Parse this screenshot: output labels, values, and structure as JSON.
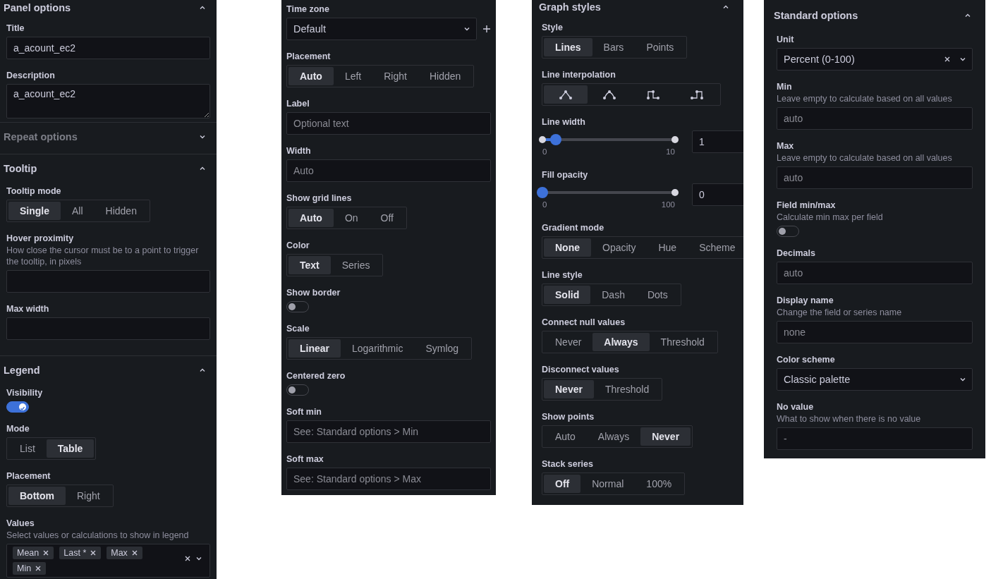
{
  "panels": [
    {
      "sections": [
        {
          "title": "Panel options",
          "expanded": true,
          "fields": [
            {
              "kind": "input",
              "label": "Title",
              "value": "a_acount_ec2"
            },
            {
              "kind": "textarea",
              "label": "Description",
              "value": "a_acount_ec2"
            }
          ]
        },
        {
          "title": "Repeat options",
          "expanded": false
        },
        {
          "title": "Tooltip",
          "expanded": true,
          "fields": [
            {
              "kind": "radio",
              "label": "Tooltip mode",
              "options": [
                {
                  "label": "Single",
                  "selected": true
                },
                {
                  "label": "All",
                  "selected": false
                },
                {
                  "label": "Hidden",
                  "selected": false
                }
              ]
            },
            {
              "kind": "input",
              "label": "Hover proximity",
              "description": "How close the cursor must be to a point to trigger the tooltip, in pixels"
            },
            {
              "kind": "input",
              "label": "Max width"
            }
          ]
        },
        {
          "title": "Legend",
          "expanded": true,
          "fields": [
            {
              "kind": "toggle",
              "label": "Visibility",
              "on": true
            },
            {
              "kind": "radio",
              "label": "Mode",
              "options": [
                {
                  "label": "List",
                  "selected": false
                },
                {
                  "label": "Table",
                  "selected": true
                }
              ]
            },
            {
              "kind": "radio",
              "label": "Placement",
              "options": [
                {
                  "label": "Bottom",
                  "selected": true
                },
                {
                  "label": "Right",
                  "selected": false
                }
              ]
            },
            {
              "kind": "multiselect",
              "label": "Values",
              "description": "Select values or calculations to show in legend",
              "tags": [
                "Mean",
                "Last *",
                "Max",
                "Min"
              ]
            }
          ]
        }
      ]
    },
    {
      "sections": [
        {
          "fields": [
            {
              "kind": "select",
              "label": "Time zone",
              "value": "Default",
              "add_button": true
            },
            {
              "kind": "radio",
              "label": "Placement",
              "options": [
                {
                  "label": "Auto",
                  "selected": true
                },
                {
                  "label": "Left",
                  "selected": false
                },
                {
                  "label": "Right",
                  "selected": false
                },
                {
                  "label": "Hidden",
                  "selected": false
                }
              ]
            },
            {
              "kind": "input",
              "label": "Label",
              "placeholder": "Optional text"
            },
            {
              "kind": "input",
              "label": "Width",
              "placeholder": "Auto"
            },
            {
              "kind": "radio",
              "label": "Show grid lines",
              "options": [
                {
                  "label": "Auto",
                  "selected": true
                },
                {
                  "label": "On",
                  "selected": false
                },
                {
                  "label": "Off",
                  "selected": false
                }
              ]
            },
            {
              "kind": "radio",
              "label": "Color",
              "options": [
                {
                  "label": "Text",
                  "selected": true
                },
                {
                  "label": "Series",
                  "selected": false
                }
              ]
            },
            {
              "kind": "toggle",
              "label": "Show border",
              "on": false
            },
            {
              "kind": "radio",
              "label": "Scale",
              "options": [
                {
                  "label": "Linear",
                  "selected": true
                },
                {
                  "label": "Logarithmic",
                  "selected": false
                },
                {
                  "label": "Symlog",
                  "selected": false
                }
              ]
            },
            {
              "kind": "toggle",
              "label": "Centered zero",
              "on": false
            },
            {
              "kind": "input",
              "label": "Soft min",
              "placeholder": "See: Standard options > Min"
            },
            {
              "kind": "input",
              "label": "Soft max",
              "placeholder": "See: Standard options > Max"
            }
          ]
        }
      ]
    },
    {
      "sections": [
        {
          "title": "Graph styles",
          "expanded": true,
          "fields": [
            {
              "kind": "radio",
              "label": "Style",
              "options": [
                {
                  "label": "Lines",
                  "selected": true
                },
                {
                  "label": "Bars",
                  "selected": false
                },
                {
                  "label": "Points",
                  "selected": false
                }
              ]
            },
            {
              "kind": "iconradio",
              "label": "Line interpolation",
              "options": [
                {
                  "selected": true
                },
                {
                  "selected": false
                },
                {
                  "selected": false
                },
                {
                  "selected": false
                }
              ]
            },
            {
              "kind": "slider",
              "label": "Line width",
              "level": 0.1,
              "min": "0",
              "max": "10",
              "value": "1"
            },
            {
              "kind": "slider",
              "label": "Fill opacity",
              "level": 0,
              "min": "0",
              "max": "100",
              "value": "0"
            },
            {
              "kind": "radio",
              "label": "Gradient mode",
              "options": [
                {
                  "label": "None",
                  "selected": true
                },
                {
                  "label": "Opacity",
                  "selected": false
                },
                {
                  "label": "Hue",
                  "selected": false
                },
                {
                  "label": "Scheme",
                  "selected": false
                }
              ]
            },
            {
              "kind": "radio",
              "label": "Line style",
              "options": [
                {
                  "label": "Solid",
                  "selected": true
                },
                {
                  "label": "Dash",
                  "selected": false
                },
                {
                  "label": "Dots",
                  "selected": false
                }
              ]
            },
            {
              "kind": "radio",
              "label": "Connect null values",
              "options": [
                {
                  "label": "Never",
                  "selected": false
                },
                {
                  "label": "Always",
                  "selected": true
                },
                {
                  "label": "Threshold",
                  "selected": false
                }
              ]
            },
            {
              "kind": "radio",
              "label": "Disconnect values",
              "options": [
                {
                  "label": "Never",
                  "selected": true
                },
                {
                  "label": "Threshold",
                  "selected": false
                }
              ]
            },
            {
              "kind": "radio",
              "label": "Show points",
              "options": [
                {
                  "label": "Auto",
                  "selected": false
                },
                {
                  "label": "Always",
                  "selected": false
                },
                {
                  "label": "Never",
                  "selected": true
                }
              ]
            },
            {
              "kind": "radio",
              "label": "Stack series",
              "options": [
                {
                  "label": "Off",
                  "selected": true
                },
                {
                  "label": "Normal",
                  "selected": false
                },
                {
                  "label": "100%",
                  "selected": false
                }
              ]
            }
          ]
        }
      ]
    },
    {
      "sections": [
        {
          "title": "Standard options",
          "expanded": true,
          "fields": [
            {
              "kind": "select",
              "label": "Unit",
              "value": "Percent (0-100)",
              "clearable": true
            },
            {
              "kind": "input",
              "label": "Min",
              "description": "Leave empty to calculate based on all values",
              "placeholder": "auto"
            },
            {
              "kind": "input",
              "label": "Max",
              "description": "Leave empty to calculate based on all values",
              "placeholder": "auto"
            },
            {
              "kind": "toggle",
              "label": "Field min/max",
              "description": "Calculate min max per field",
              "on": false
            },
            {
              "kind": "input",
              "label": "Decimals",
              "placeholder": "auto"
            },
            {
              "kind": "input",
              "label": "Display name",
              "description": "Change the field or series name",
              "placeholder": "none"
            },
            {
              "kind": "select",
              "label": "Color scheme",
              "value": "Classic palette"
            },
            {
              "kind": "input",
              "label": "No value",
              "description": "What to show when there is no value",
              "placeholder": "-"
            }
          ]
        }
      ]
    }
  ]
}
